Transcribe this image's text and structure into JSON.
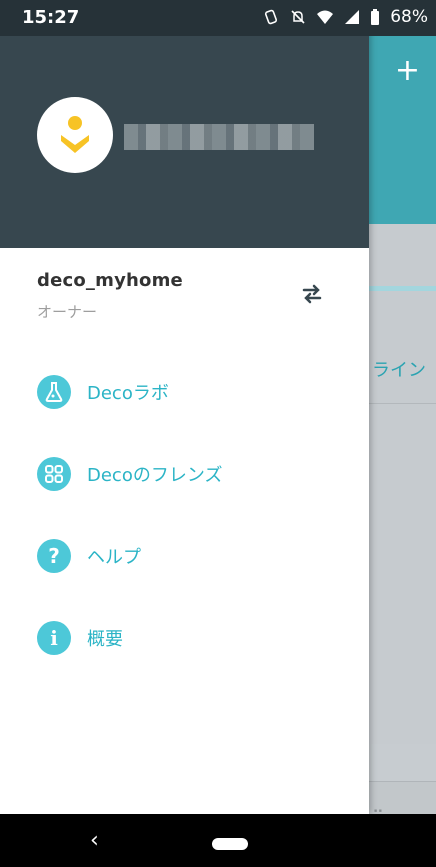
{
  "status_bar": {
    "time": "15:27",
    "battery": "68%"
  },
  "background_app": {
    "add_button": "+",
    "status_text": "ライン"
  },
  "drawer": {
    "account_name": "deco_myhome",
    "account_role": "オーナー",
    "menu": [
      {
        "label": "Decoラボ",
        "icon": "lab-flask-icon"
      },
      {
        "label": "Decoのフレンズ",
        "icon": "apps-grid-icon"
      },
      {
        "label": "ヘルプ",
        "icon": "help-icon"
      },
      {
        "label": "概要",
        "icon": "info-icon"
      }
    ]
  },
  "nav_bar": {
    "back": "‹"
  },
  "colors": {
    "accent": "#4dc8d8",
    "header": "#37474f",
    "logo_yellow": "#f7c325"
  }
}
